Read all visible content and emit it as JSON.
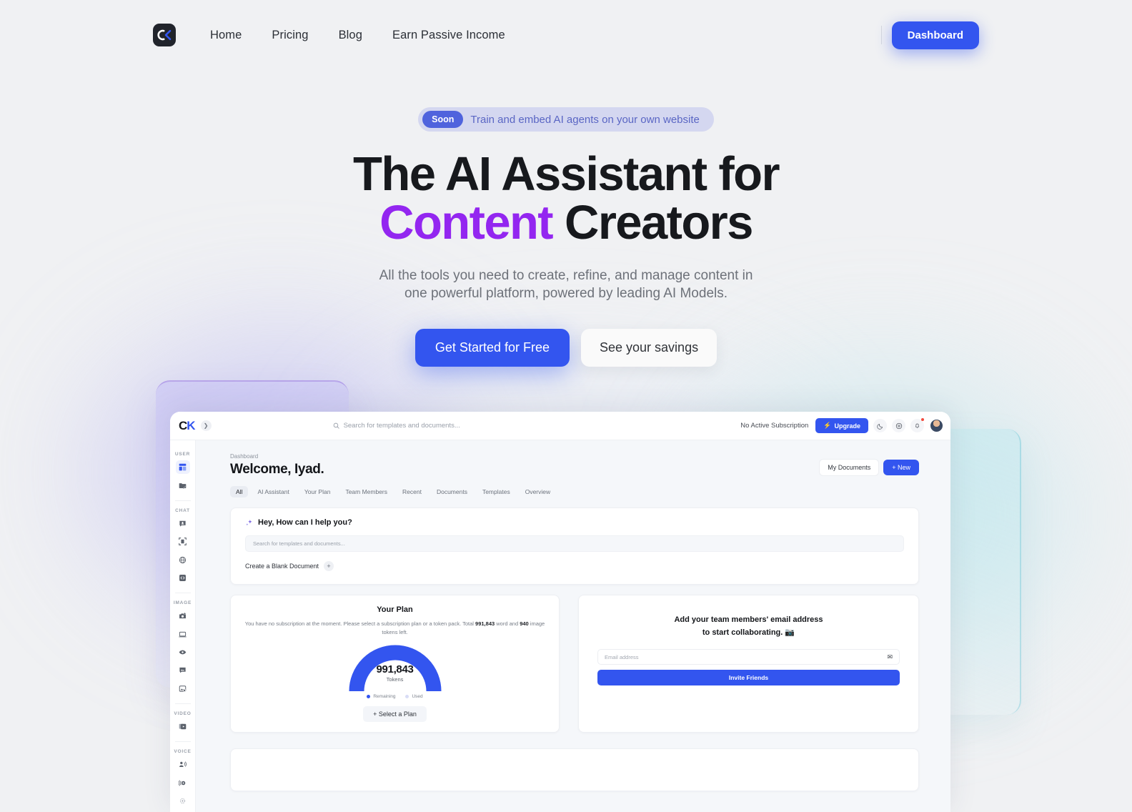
{
  "nav": {
    "logo_icon": "ck-logo-icon",
    "links": [
      {
        "label": "Home"
      },
      {
        "label": "Pricing"
      },
      {
        "label": "Blog"
      },
      {
        "label": "Earn Passive Income"
      }
    ],
    "dashboard_button": "Dashboard"
  },
  "hero": {
    "pill_badge": "Soon",
    "pill_text": "Train and embed AI agents on your own website",
    "headline_line1": "The AI Assistant for",
    "headline_accent": "Content",
    "headline_line2_rest": " Creators",
    "subtitle_line1": "All the tools you need to create, refine, and manage content in",
    "subtitle_line2": "one powerful platform, powered by leading AI Models.",
    "cta_primary": "Get Started for Free",
    "cta_secondary": "See your savings",
    "accent_color": "#9326f0",
    "brand_color": "#3355ef"
  },
  "app": {
    "logo_text": "CK",
    "topbar": {
      "search_placeholder": "Search for templates and documents...",
      "subscription_status": "No Active Subscription",
      "upgrade_label": "Upgrade",
      "theme_icon": "moon-icon",
      "help_icon": "lifebuoy-icon",
      "bell_icon": "bell-icon",
      "avatar": "user-avatar"
    },
    "sidebar": {
      "groups": [
        {
          "label": "USER",
          "items": [
            {
              "icon": "dashboard-grid-icon",
              "active": true
            },
            {
              "icon": "edit-folder-icon",
              "active": false
            }
          ]
        },
        {
          "label": "CHAT",
          "items": [
            {
              "icon": "chat-person-icon",
              "active": false
            },
            {
              "icon": "scan-document-icon",
              "active": false
            },
            {
              "icon": "globe-icon",
              "active": false
            },
            {
              "icon": "code-icon",
              "active": false
            }
          ]
        },
        {
          "label": "IMAGE",
          "items": [
            {
              "icon": "camera-plus-icon",
              "active": false
            },
            {
              "icon": "monitor-icon",
              "active": false
            },
            {
              "icon": "eye-icon",
              "active": false
            },
            {
              "icon": "image-chat-icon",
              "active": false
            },
            {
              "icon": "image-settings-icon",
              "active": false
            }
          ]
        },
        {
          "label": "VIDEO",
          "items": [
            {
              "icon": "video-layers-icon",
              "active": false
            }
          ]
        },
        {
          "label": "VOICE",
          "items": [
            {
              "icon": "speaking-person-icon",
              "active": false
            },
            {
              "icon": "audio-wave-icon",
              "active": false
            },
            {
              "icon": "voice-network-icon",
              "active": false
            }
          ]
        }
      ]
    },
    "main": {
      "breadcrumb": "Dashboard",
      "welcome": "Welcome, Iyad.",
      "my_documents_label": "My Documents",
      "new_label": "+ New",
      "tabs": [
        {
          "label": "All",
          "active": true
        },
        {
          "label": "AI Assistant",
          "active": false
        },
        {
          "label": "Your Plan",
          "active": false
        },
        {
          "label": "Team Members",
          "active": false
        },
        {
          "label": "Recent",
          "active": false
        },
        {
          "label": "Documents",
          "active": false
        },
        {
          "label": "Templates",
          "active": false
        },
        {
          "label": "Overview",
          "active": false
        }
      ],
      "assistant": {
        "title": "Hey, How can I help you?",
        "sparkle_icon": "sparkle-icon",
        "search_placeholder": "Search for templates and documents...",
        "blank_doc_label": "Create a Blank Document",
        "plus_icon": "plus-icon"
      },
      "plan_card": {
        "title": "Your Plan",
        "desc_part1": "You have no subscription at the moment. Please select a subscription plan or a token pack. Total ",
        "word_tokens": "991,843",
        "desc_part2": " word and ",
        "image_tokens": "940",
        "desc_part3": " image tokens left.",
        "gauge_value": "991,843",
        "gauge_label": "Tokens",
        "legend": [
          {
            "label": "Remaining",
            "color": "#3355ef"
          },
          {
            "label": "Used",
            "color": "#d9ddf6"
          }
        ],
        "select_plan_label": "+  Select a Plan"
      },
      "team_card": {
        "title_line1": "Add your team members' email address",
        "title_line2": "to start collaborating.",
        "emoji_icon": "camera-emoji-icon",
        "email_placeholder": "Email address",
        "envelope_icon": "envelope-icon",
        "invite_label": "Invite Friends"
      }
    }
  },
  "chart_data": {
    "type": "pie",
    "title": "Your Plan token usage",
    "categories": [
      "Remaining",
      "Used"
    ],
    "values": [
      991843,
      0
    ],
    "colors": [
      "#3355ef",
      "#d9ddf6"
    ],
    "center_label": "991,843",
    "center_sublabel": "Tokens",
    "legend_position": "bottom",
    "notes": "Semicircular gauge, 100% remaining"
  }
}
